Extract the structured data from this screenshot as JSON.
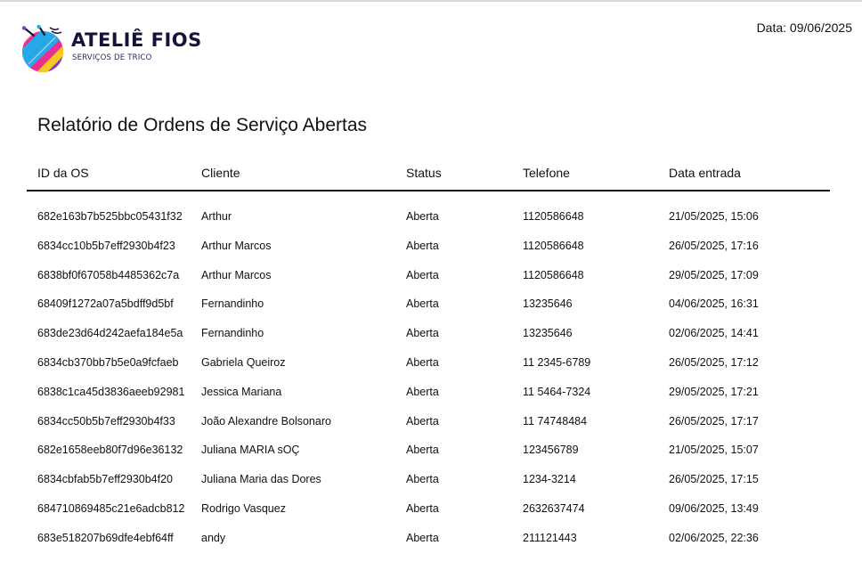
{
  "brand": {
    "name": "ATELIÊ FIOS",
    "tagline": "SERVIÇOS DE TRICO",
    "logo_icon": "yarn-ball-logo-icon",
    "colors": {
      "pink": "#ec2f8f",
      "yellow": "#f7c81e",
      "blue": "#27a7e7",
      "purple": "#7a3fc4",
      "navy": "#14143a"
    }
  },
  "header": {
    "date_label": "Data:",
    "date_value": "09/06/2025"
  },
  "report": {
    "title": "Relatório de Ordens de Serviço Abertas"
  },
  "table": {
    "columns": [
      "ID da OS",
      "Cliente",
      "Status",
      "Telefone",
      "Data entrada"
    ],
    "rows": [
      [
        "682e163b7b525bbc05431f32",
        "Arthur",
        "Aberta",
        "1120586648",
        "21/05/2025, 15:06"
      ],
      [
        "6834cc10b5b7eff2930b4f23",
        "Arthur Marcos",
        "Aberta",
        "1120586648",
        "26/05/2025, 17:16"
      ],
      [
        "6838bf0f67058b4485362c7a",
        "Arthur Marcos",
        "Aberta",
        "1120586648",
        "29/05/2025, 17:09"
      ],
      [
        "68409f1272a07a5bdff9d5bf",
        "Fernandinho",
        "Aberta",
        "13235646",
        "04/06/2025, 16:31"
      ],
      [
        "683de23d64d242aefa184e5a",
        "Fernandinho",
        "Aberta",
        "13235646",
        "02/06/2025, 14:41"
      ],
      [
        "6834cb370bb7b5e0a9fcfaeb",
        "Gabriela Queiroz",
        "Aberta",
        "11 2345-6789",
        "26/05/2025, 17:12"
      ],
      [
        "6838c1ca45d3836aeeb92981",
        "Jessica Mariana",
        "Aberta",
        "11 5464-7324",
        "29/05/2025, 17:21"
      ],
      [
        "6834cc50b5b7eff2930b4f33",
        "João Alexandre Bolsonaro",
        "Aberta",
        "11 74748484",
        "26/05/2025, 17:17"
      ],
      [
        "682e1658eeb80f7d96e36132",
        "Juliana MARIA sOÇ",
        "Aberta",
        "123456789",
        "21/05/2025, 15:07"
      ],
      [
        "6834cbfab5b7eff2930b4f20",
        "Juliana Maria das Dores",
        "Aberta",
        "1234-3214",
        "26/05/2025, 17:15"
      ],
      [
        "684710869485c21e6adcb812",
        "Rodrigo Vasquez",
        "Aberta",
        "2632637474",
        "09/06/2025, 13:49"
      ],
      [
        "683e518207b69dfe4ebf64ff",
        "andy",
        "Aberta",
        "211121443",
        "02/06/2025, 22:36"
      ]
    ]
  }
}
